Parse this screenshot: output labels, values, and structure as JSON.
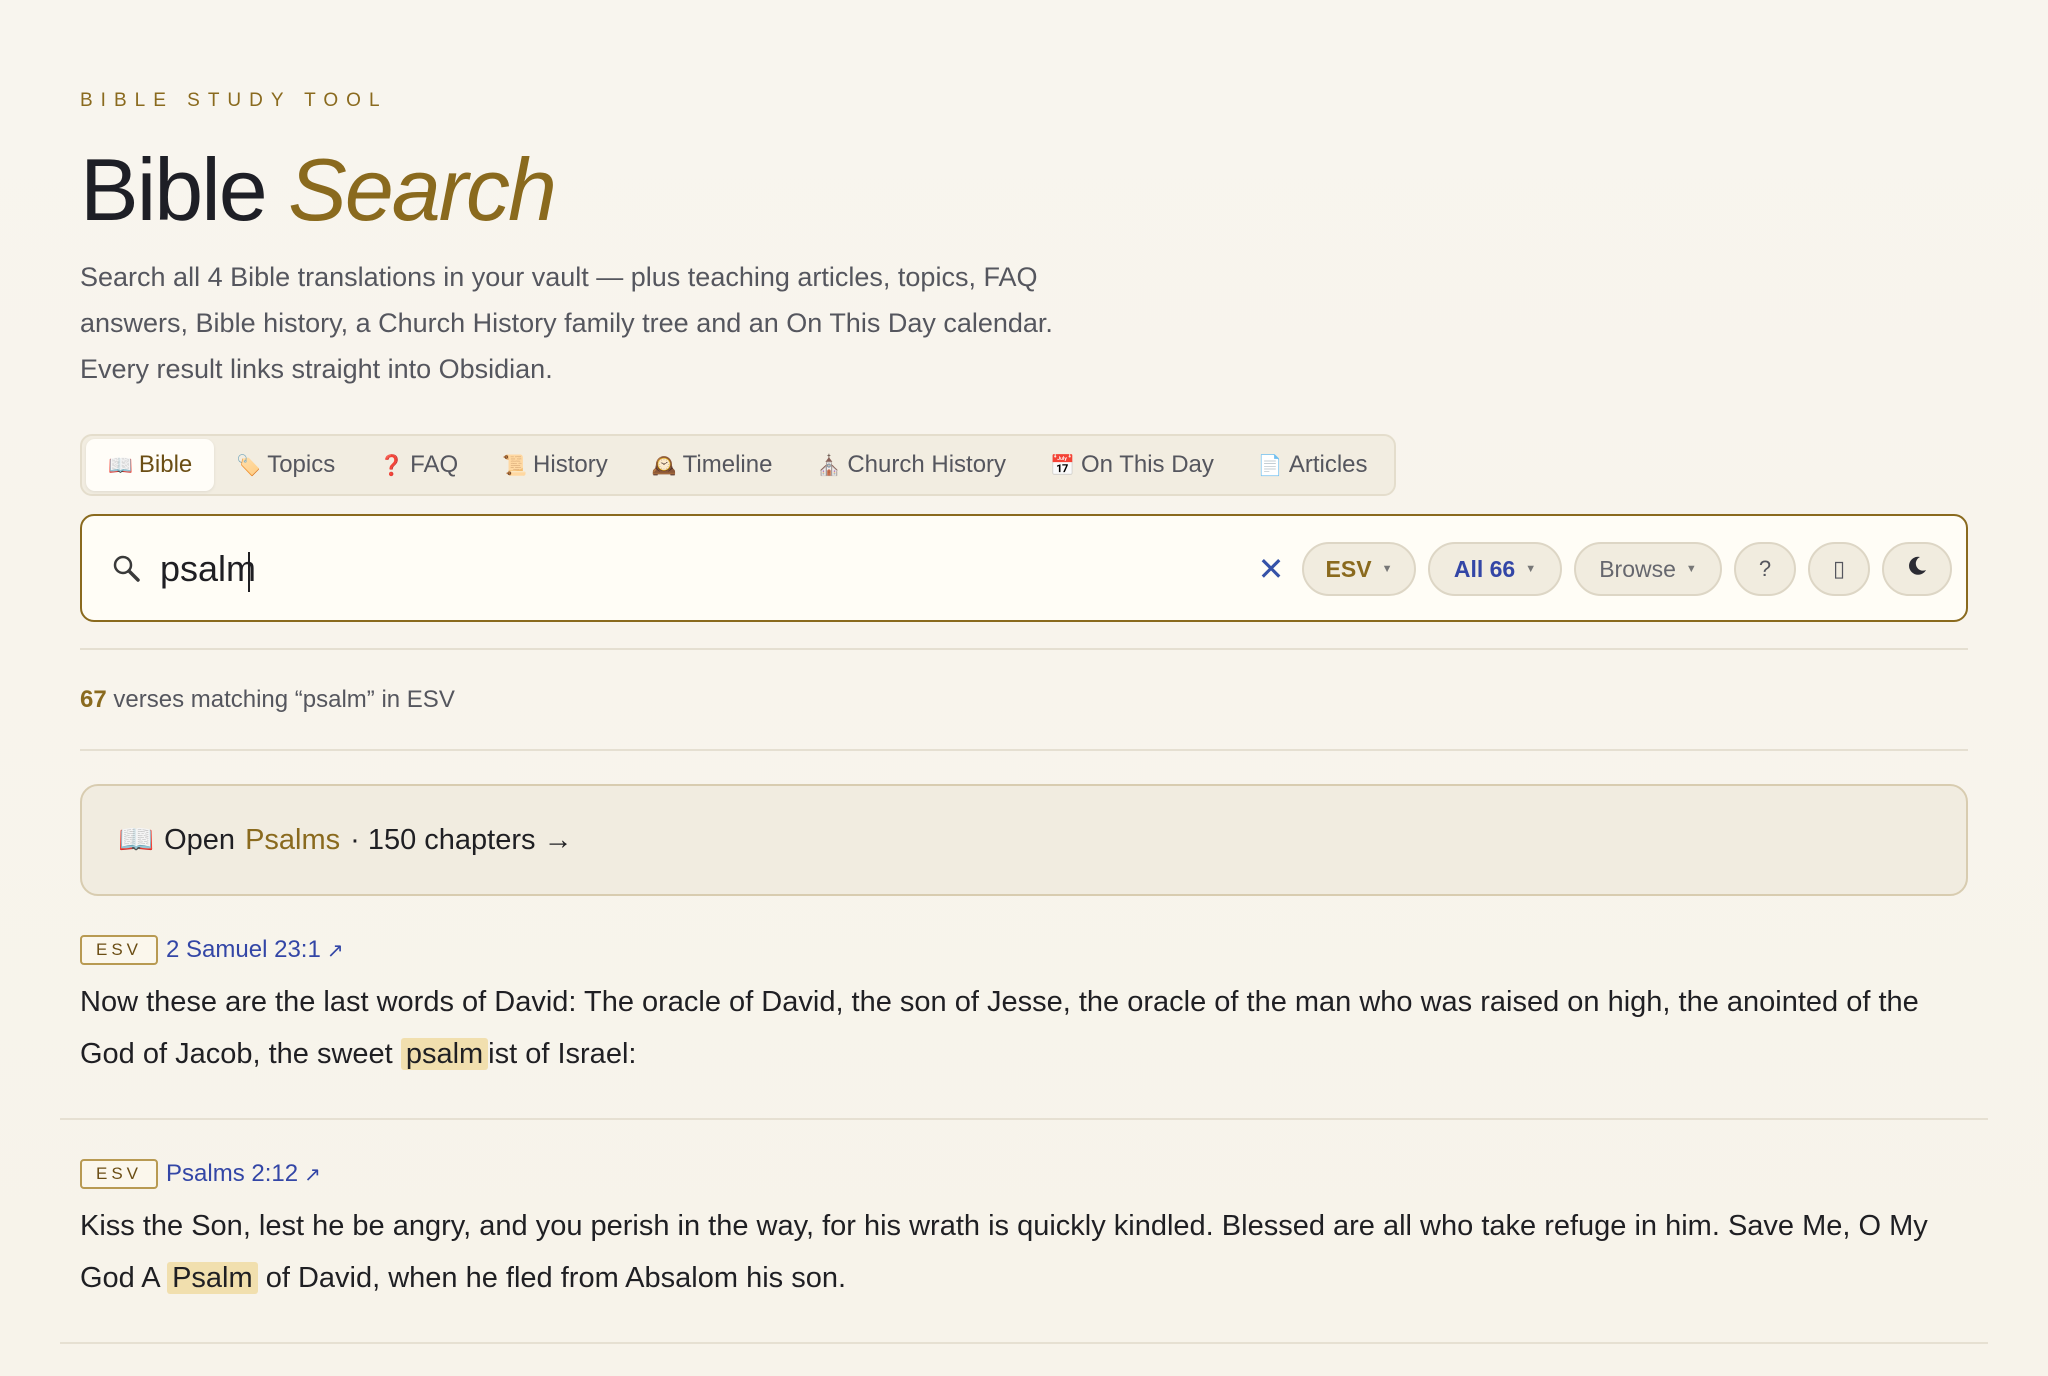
{
  "header": {
    "eyebrow": "BIBLE STUDY TOOL",
    "title_main": "Bible",
    "title_accent": "Search",
    "description": "Search all 4 Bible translations in your vault — plus teaching articles, topics, FAQ answers, Bible history, a Church History family tree and an On This Day calendar. Every result links straight into Obsidian."
  },
  "tabs": [
    {
      "icon": "📖",
      "label": "Bible",
      "active": true
    },
    {
      "icon": "🏷️",
      "label": "Topics"
    },
    {
      "icon": "❓",
      "label": "FAQ"
    },
    {
      "icon": "📜",
      "label": "History"
    },
    {
      "icon": "🕰️",
      "label": "Timeline"
    },
    {
      "icon": "⛪",
      "label": "Church History"
    },
    {
      "icon": "📅",
      "label": "On This Day"
    },
    {
      "icon": "📄",
      "label": "Articles"
    }
  ],
  "search": {
    "value": "psalm",
    "clear_label": "✕",
    "translation": "ESV",
    "scope": "All 66",
    "browse": "Browse",
    "help": "?",
    "book_btn": "▯",
    "theme_btn": "☾"
  },
  "results_summary": {
    "count": "67",
    "text": "verses matching “psalm” in ESV"
  },
  "open_book": {
    "icon": "📖",
    "prefix": "Open",
    "book": "Psalms",
    "suffix": "· 150 chapters →"
  },
  "results": [
    {
      "badge": "ESV",
      "reference": "2 Samuel 23:1",
      "text_before": "Now these are the last words of David: The oracle of David, the son of Jesse, the oracle of the man who was raised on high, the anointed of the God of Jacob, the sweet ",
      "match": "psalm",
      "text_after": "ist of Israel:"
    },
    {
      "badge": "ESV",
      "reference": "Psalms 2:12",
      "text_before": "Kiss the Son, lest he be angry, and you perish in the way, for his wrath is quickly kindled. Blessed are all who take refuge in him. Save Me, O My God A ",
      "match": "Psalm",
      "text_after": " of David, when he fled from Absalom his son."
    }
  ],
  "colors": {
    "accent": "#8a6a1e",
    "link": "#3346a6",
    "highlight": "#f1dfae",
    "background": "#f8f5ee"
  }
}
